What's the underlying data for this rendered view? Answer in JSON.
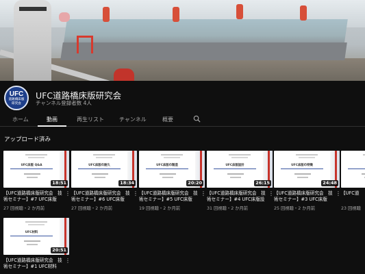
{
  "banner": {
    "alt": "channel-banner"
  },
  "channel": {
    "avatar_line1": "UFC",
    "avatar_line2": "道路橋床版",
    "avatar_line3": "研究会",
    "name": "UFC道路橋床版研究会",
    "subscribers": "チャンネル登録者数 4人"
  },
  "tabs": [
    {
      "label": "ホーム"
    },
    {
      "label": "動画"
    },
    {
      "label": "再生リスト"
    },
    {
      "label": "チャンネル"
    },
    {
      "label": "概要"
    }
  ],
  "section_title": "アップロード済み",
  "videos": [
    {
      "thumb_title": "UFC床版 Q&A",
      "duration": "18:51",
      "title": "【UFC道路橋床版研究会　技術セミナー】#7 UFC床版の…",
      "meta": "27 回視聴・2 か月前"
    },
    {
      "thumb_title": "UFC床版の耐久",
      "duration": "18:34",
      "title": "【UFC道路橋床版研究会　技術セミナー】#6 UFC床版の…",
      "meta": "27 回視聴・2 か月前"
    },
    {
      "thumb_title": "UFC床版の製造",
      "duration": "20:20",
      "title": "【UFC道路橋床版研究会　技術セミナー】#5 UFC床版の…",
      "meta": "19 回視聴・2 か月前"
    },
    {
      "thumb_title": "UFC床版設計",
      "duration": "26:15",
      "title": "【UFC道路橋床版研究会　技術セミナー】#4 UFC床版設計",
      "meta": "31 回視聴・2 か月前"
    },
    {
      "thumb_title": "UFC床版の特徴",
      "duration": "24:48",
      "title": "【UFC道路橋床版研究会　技術セミナー】#3 UFC床版の…",
      "meta": "25 回視聴・2 か月前"
    },
    {
      "thumb_title": "",
      "duration": "",
      "title": "【UFC道",
      "meta": "23 回視聴"
    },
    {
      "thumb_title": "UFC材料",
      "duration": "20:51",
      "title": "【UFC道路橋床版研究会　技術セミナー】#1 UFC材料",
      "meta": ""
    }
  ]
}
